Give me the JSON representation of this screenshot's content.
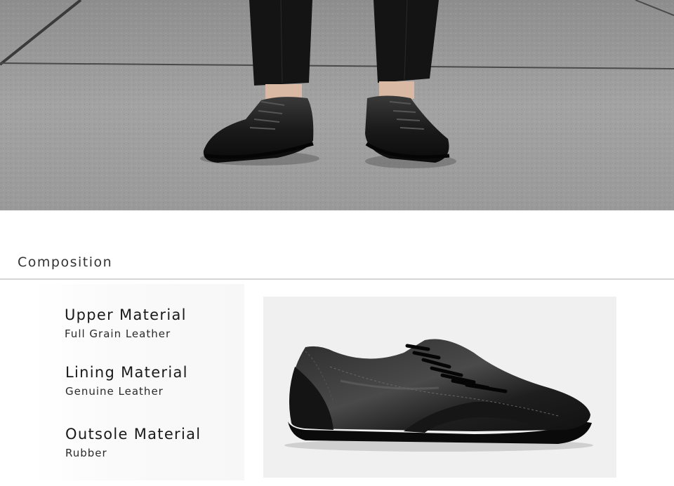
{
  "section": {
    "title": "Composition"
  },
  "materials": [
    {
      "title": "Upper Material",
      "value": "Full Grain Leather"
    },
    {
      "title": "Lining Material",
      "value": "Genuine Leather"
    },
    {
      "title": "Outsole Material",
      "value": "Rubber"
    }
  ],
  "images": {
    "hero": "photo-legs-wearing-black-sneakers-on-concrete",
    "product": "photo-black-leather-sneaker-side-view"
  },
  "colors": {
    "divider": "#d6d6d6",
    "text": "#1a1a1a",
    "concrete": "#9a9a9a",
    "product_bg": "#f0f0f0"
  }
}
